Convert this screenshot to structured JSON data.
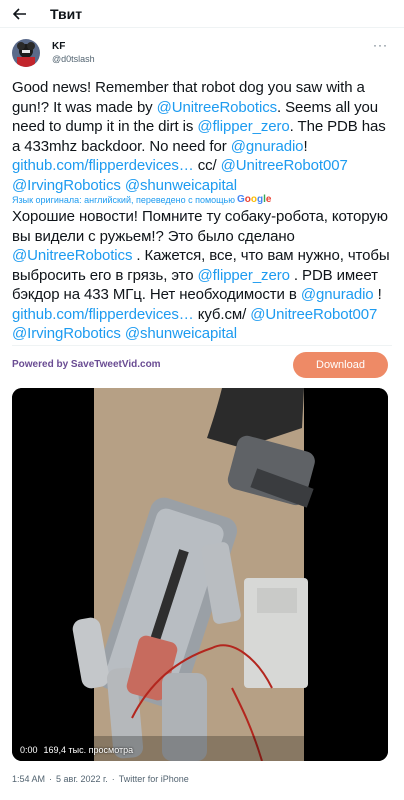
{
  "header": {
    "title": "Твит"
  },
  "author": {
    "display_name": "KF",
    "handle": "@d0tslash",
    "more": "···"
  },
  "tweet": {
    "p1": "Good news! Remember that robot dog you saw with a gun!? It was made by ",
    "m1": "@UnitreeRobotics",
    "p2": ". Seems all you need to dump it in the dirt is ",
    "m2": "@flipper_zero",
    "p3": ". The PDB has a 433mhz backdoor. No need for ",
    "m3": "@gnuradio",
    "p4": "! ",
    "l1": "github.com/flipperdevices…",
    "p5": " cc/ ",
    "m4": "@UnitreeRobot007",
    "p6": " ",
    "m5": "@IrvingRobotics",
    "p7": " ",
    "m6": "@shunweicapital"
  },
  "translate_note": "Язык оригинала: английский, переведено с помощью",
  "google": {
    "g": "G",
    "o1": "o",
    "o2": "o",
    "g2": "g",
    "l": "l",
    "e": "e"
  },
  "translated": {
    "t1": "Хорошие новости! Помните ту собаку-робота, которую вы видели с ружьем!? Это было сделано ",
    "m1": "@UnitreeRobotics",
    "t2": " . Кажется, все, что вам нужно, чтобы выбросить его в грязь, это ",
    "m2": "@flipper_zero",
    "t3": " . PDB имеет бэкдор на 433 МГц. Нет необходимости в ",
    "m3": "@gnuradio",
    "t4": " ! ",
    "l1": "github.com/flipperdevices…",
    "t5": " куб.см/ ",
    "m4": "@UnitreeRobot007",
    "t6": " ",
    "m5": "@IrvingRobotics",
    "t7": " ",
    "m6": "@shunweicapital"
  },
  "powered": {
    "prefix": "Powered by ",
    "brand": "SaveTweetVid.com"
  },
  "download_label": "Download",
  "video": {
    "time": "0:00",
    "views": "169,4 тыс. просмотра"
  },
  "meta": {
    "time": "1:54 AM",
    "sep1": "·",
    "date": "5 авг. 2022 г.",
    "sep2": "·",
    "source": "Twitter for iPhone"
  },
  "colors": {
    "link": "#1d9bf0",
    "download": "#ee8a66",
    "powered": "#6a4c93"
  }
}
